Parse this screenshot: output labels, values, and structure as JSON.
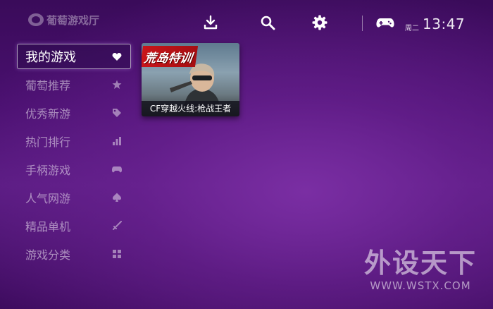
{
  "header": {
    "logo_text": "葡萄游戏厅",
    "icons": {
      "download": "download-icon",
      "search": "search-icon",
      "settings": "gear-icon",
      "gamepad": "gamepad-icon"
    },
    "weekday": "周二",
    "time": "13:47"
  },
  "sidebar": {
    "items": [
      {
        "label": "我的游戏",
        "icon": "heart-icon",
        "active": true
      },
      {
        "label": "葡萄推荐",
        "icon": "star-icon"
      },
      {
        "label": "优秀新游",
        "icon": "tag-icon"
      },
      {
        "label": "热门排行",
        "icon": "bar-chart-icon"
      },
      {
        "label": "手柄游戏",
        "icon": "gamepad-icon"
      },
      {
        "label": "人气网游",
        "icon": "spade-icon"
      },
      {
        "label": "精品单机",
        "icon": "sword-icon"
      },
      {
        "label": "游戏分类",
        "icon": "grid-icon"
      }
    ]
  },
  "games": [
    {
      "banner_text": "荒岛特训",
      "title": "CF穿越火线:枪战王者"
    }
  ],
  "watermark": {
    "main": "外设天下",
    "url": "WWW.WSTX.COM"
  },
  "colors": {
    "bg_top": "#3a0b5a",
    "bg_center": "#7a2ea3",
    "banner_red": "#c9151a"
  }
}
